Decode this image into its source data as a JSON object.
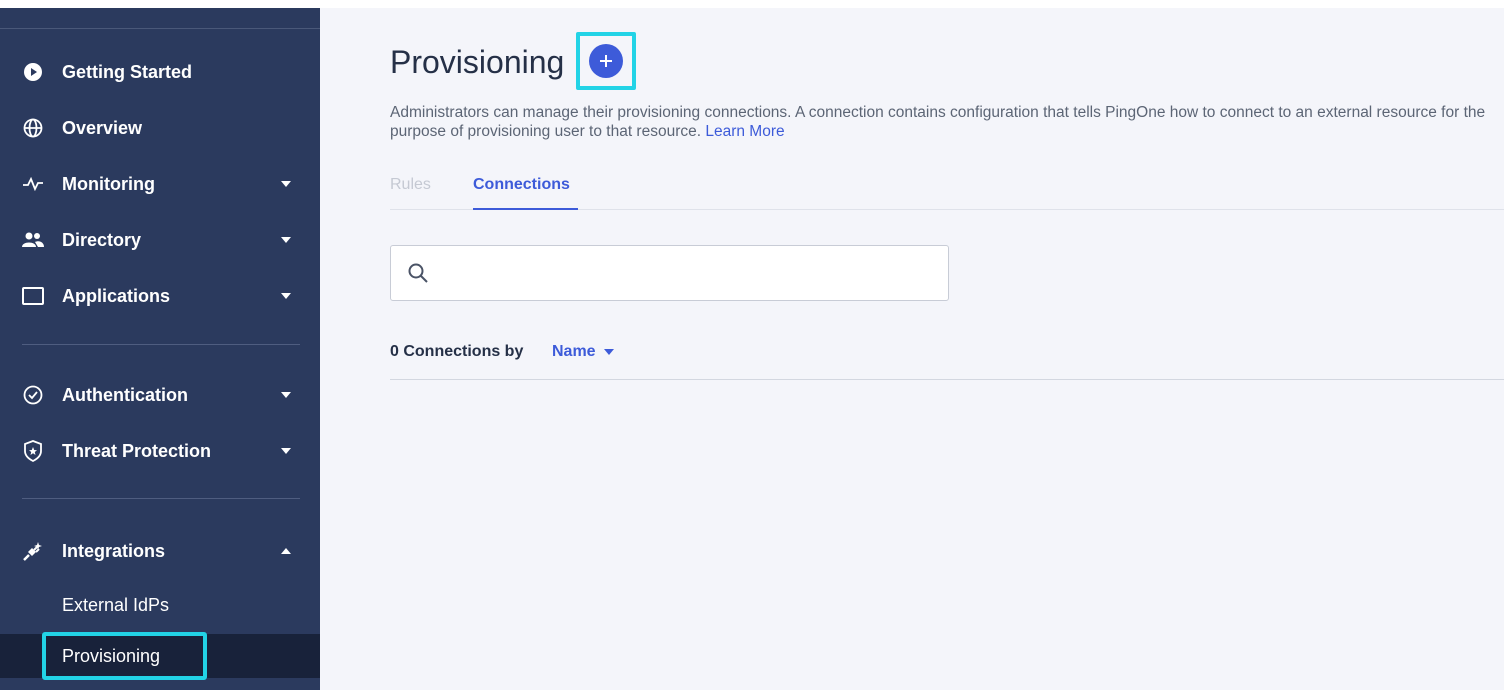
{
  "sidebar": {
    "items": [
      {
        "label": "Getting Started",
        "icon": "play-circle-icon"
      },
      {
        "label": "Overview",
        "icon": "globe-icon"
      },
      {
        "label": "Monitoring",
        "icon": "pulse-icon"
      },
      {
        "label": "Directory",
        "icon": "users-icon"
      },
      {
        "label": "Applications",
        "icon": "window-icon"
      },
      {
        "label": "Authentication",
        "icon": "check-circle-icon"
      },
      {
        "label": "Threat Protection",
        "icon": "shield-star-icon"
      },
      {
        "label": "Integrations",
        "icon": "plug-icon"
      }
    ],
    "sub_items": [
      {
        "label": "External IdPs"
      },
      {
        "label": "Provisioning"
      }
    ]
  },
  "main": {
    "title": "Provisioning",
    "description": "Administrators can manage their provisioning connections. A connection contains configuration that tells PingOne how to connect to an external resource for the purpose of provisioning user to that resource. ",
    "learn_more": "Learn More",
    "tabs": [
      {
        "label": "Rules"
      },
      {
        "label": "Connections"
      }
    ],
    "search": {
      "placeholder": ""
    },
    "count_label": "0 Connections by",
    "sort_label": "Name"
  },
  "colors": {
    "sidebar_bg": "#2b3a5e",
    "active_bg": "#18223a",
    "accent": "#3d5bd9",
    "highlight": "#22d3e6",
    "main_bg": "#f4f5fa"
  }
}
